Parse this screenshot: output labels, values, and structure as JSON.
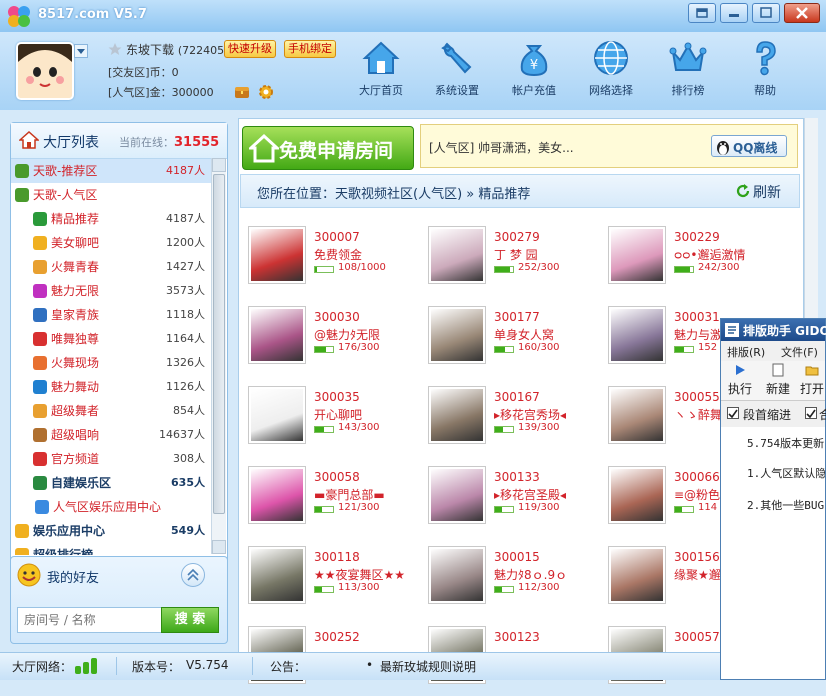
{
  "window": {
    "title": "8517.com V5.7"
  },
  "user": {
    "name": "东坡下载",
    "id_partial": "(7224054",
    "jiaoyou_label": "[交友区]币：",
    "jiaoyou_value": "0",
    "renqi_label": "[人气区]金：",
    "renqi_value": "300000",
    "quick_upgrade": "快速升级",
    "bind_phone": "手机绑定"
  },
  "toolbar": [
    {
      "label": "大厅首页",
      "icon": "house-icon"
    },
    {
      "label": "系统设置",
      "icon": "wrench-icon"
    },
    {
      "label": "帐户充值",
      "icon": "money-bag-icon"
    },
    {
      "label": "网络选择",
      "icon": "globe-icon"
    },
    {
      "label": "排行榜",
      "icon": "crown-icon"
    },
    {
      "label": "帮助",
      "icon": "help-icon"
    }
  ],
  "lobby": {
    "title": "大厅列表",
    "online_label": "当前在线：",
    "online_count": "31555",
    "items": [
      {
        "name": "天歌-推荐区",
        "count": "4187人",
        "level": 0,
        "icon_color": "#4a9a2c"
      },
      {
        "name": "天歌-人气区",
        "count": "",
        "level": 0,
        "icon_color": "#4a9a2c"
      },
      {
        "name": "精品推荐",
        "count": "4187人",
        "level": 1,
        "icon_color": "#2a9a3a"
      },
      {
        "name": "美女聊吧",
        "count": "1200人",
        "level": 1,
        "icon_color": "#f0b020"
      },
      {
        "name": "火舞青春",
        "count": "1427人",
        "level": 1,
        "icon_color": "#e8a030"
      },
      {
        "name": "魅力无限",
        "count": "3573人",
        "level": 1,
        "icon_color": "#c030c0"
      },
      {
        "name": "皇家青族",
        "count": "1118人",
        "level": 1,
        "icon_color": "#3070c0"
      },
      {
        "name": "唯舞独尊",
        "count": "1164人",
        "level": 1,
        "icon_color": "#d83030"
      },
      {
        "name": "火舞现场",
        "count": "1326人",
        "level": 1,
        "icon_color": "#e87030"
      },
      {
        "name": "魅力舞动",
        "count": "1126人",
        "level": 1,
        "icon_color": "#2080d0"
      },
      {
        "name": "超级舞者",
        "count": "854人",
        "level": 1,
        "icon_color": "#e8a030"
      },
      {
        "name": "超级唱响",
        "count": "14637人",
        "level": 1,
        "icon_color": "#b07030"
      },
      {
        "name": "官方频道",
        "count": "308人",
        "level": 1,
        "icon_color": "#d83030"
      },
      {
        "name": "自建娱乐区",
        "count": "635人",
        "level": 1,
        "icon_color": "#2a8a40",
        "bold": true
      },
      {
        "name": "人气区娱乐应用中心",
        "count": "",
        "level": 2,
        "icon_color": "#3a8ae0"
      },
      {
        "name": "娱乐应用中心",
        "count": "549人",
        "level": 0,
        "icon_color": "#f0b020",
        "bold": true
      },
      {
        "name": "超级排行榜",
        "count": "",
        "level": 0,
        "icon_color": "#f0b020",
        "bold": true
      }
    ]
  },
  "friends": {
    "title": "我的好友",
    "search_placeholder": "房间号 / 名称",
    "search_button": "搜 索"
  },
  "main": {
    "free_room_button": "免费申请房间",
    "ad_text": "[人气区] 帅哥潇洒，美女...",
    "qq_offline": "QQ离线",
    "breadcrumb": "您所在位置：天歌视频社区(人气区) » 精品推荐",
    "refresh": "刷新"
  },
  "rooms": [
    {
      "id": "300007",
      "name": "免费领金",
      "count": "108/1000",
      "fill": 0.11,
      "color": "#c33"
    },
    {
      "id": "300279",
      "name": "丁 梦 园",
      "count": "252/300",
      "fill": 0.84,
      "color": "#cab"
    },
    {
      "id": "300229",
      "name": "ᴑᴑ•邂逅激情",
      "count": "242/300",
      "fill": 0.81,
      "color": "#d9b"
    },
    {
      "id": "300030",
      "name": "@魅力ﾀ无限",
      "count": "176/300",
      "fill": 0.59,
      "color": "#a58"
    },
    {
      "id": "300177",
      "name": "单身女人窝",
      "count": "160/300",
      "fill": 0.53,
      "color": "#987"
    },
    {
      "id": "300031",
      "name": "魅力与激",
      "count": "152",
      "fill": 0.5,
      "color": "#879"
    },
    {
      "id": "300035",
      "name": "开心聊吧",
      "count": "143/300",
      "fill": 0.48,
      "color": "#eee"
    },
    {
      "id": "300167",
      "name": "▸移花宫秀场◂",
      "count": "139/300",
      "fill": 0.46,
      "color": "#876"
    },
    {
      "id": "300055",
      "name": "ヽゝ醉舞",
      "count": "",
      "fill": 0.45,
      "color": "#a87"
    },
    {
      "id": "300058",
      "name": "▬豪門总部▬",
      "count": "121/300",
      "fill": 0.4,
      "color": "#d5a"
    },
    {
      "id": "300133",
      "name": "▸移花宫圣殿◂",
      "count": "119/300",
      "fill": 0.4,
      "color": "#b8a"
    },
    {
      "id": "300066",
      "name": "≡@粉色",
      "count": "114",
      "fill": 0.38,
      "color": "#a65"
    },
    {
      "id": "300118",
      "name": "★★夜宴舞区★★",
      "count": "113/300",
      "fill": 0.38,
      "color": "#776"
    },
    {
      "id": "300015",
      "name": "魅力ﾀ8ｏ.9ｏ",
      "count": "112/300",
      "fill": 0.37,
      "color": "#988"
    },
    {
      "id": "300156",
      "name": "缘聚★邂",
      "count": "",
      "fill": 0.37,
      "color": "#a76"
    },
    {
      "id": "300252",
      "name": "",
      "count": "",
      "fill": 0,
      "color": "#665"
    },
    {
      "id": "300123",
      "name": "",
      "count": "",
      "fill": 0,
      "color": "#776"
    },
    {
      "id": "300057",
      "name": "",
      "count": "",
      "fill": 0,
      "color": "#887"
    }
  ],
  "popup": {
    "title": "排版助手 GIDO",
    "menu_layout": "排版(R)",
    "menu_file": "文件(F)",
    "exec": "执行",
    "new": "新建",
    "open": "打开",
    "indent": "段首缩进",
    "merge": "合",
    "line1": "5.754版本更新",
    "line2": "1.人气区默认隐",
    "line3": "2.其他一些BUG"
  },
  "status": {
    "network_label": "大厅网络：",
    "version_label": "版本号：",
    "version": "V5.754",
    "notice_label": "公告：",
    "notice_bullet": "•",
    "notice": "最新玫城规则说明"
  }
}
